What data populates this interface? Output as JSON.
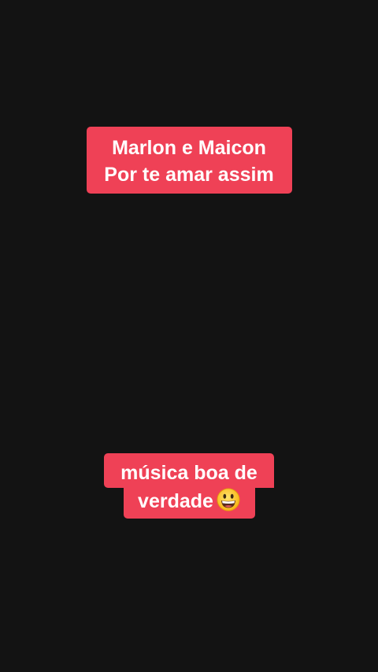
{
  "caption_top": {
    "line1": "Marlon e Maicon",
    "line2": "Por te amar assim"
  },
  "caption_bottom": {
    "line1": "música boa de",
    "line2": "verdade",
    "emoji": "grinning-face-icon"
  },
  "colors": {
    "background": "#131313",
    "caption_bg": "#ef4156",
    "caption_text": "#ffffff"
  }
}
